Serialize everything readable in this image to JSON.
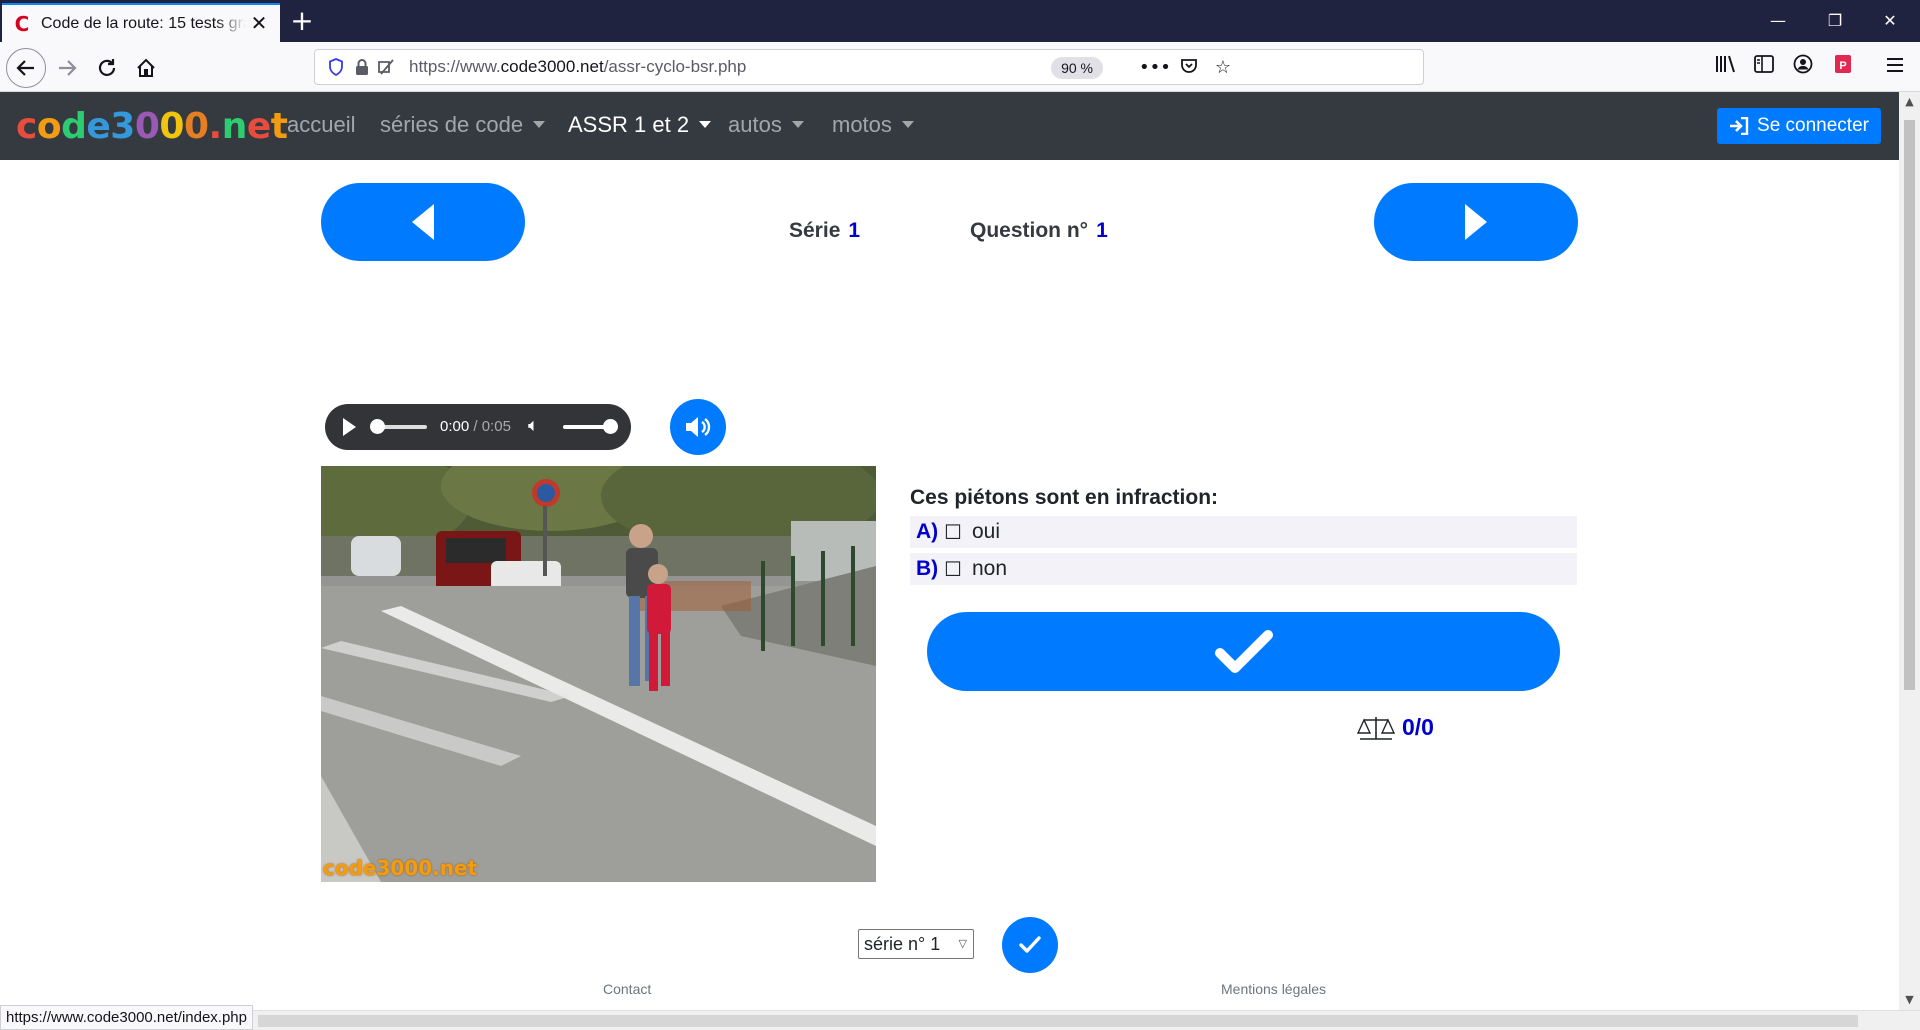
{
  "browser": {
    "tab_title": "Code de la route: 15 tests gratuits",
    "favicon_letter": "C",
    "new_tab_label": "+",
    "url_prefix": "https://www.",
    "url_domain": "code3000.net",
    "url_path": "/assr-cyclo-bsr.php",
    "zoom": "90 %",
    "status_url": "https://www.code3000.net/index.php",
    "icons": [
      "shield-icon",
      "lock-icon",
      "tracking-icon",
      "more-icon",
      "pocket-icon",
      "bookmark-star-icon",
      "library-icon",
      "sidebar-icon",
      "account-icon",
      "extension-icon",
      "menu-icon"
    ]
  },
  "site": {
    "logo_letters": [
      {
        "ch": "c",
        "color": "#e74c3c"
      },
      {
        "ch": "o",
        "color": "#f39c12"
      },
      {
        "ch": "d",
        "color": "#2ecc71"
      },
      {
        "ch": "e",
        "color": "#3498db"
      },
      {
        "ch": "3",
        "color": "#3498db"
      },
      {
        "ch": "0",
        "color": "#9b59b6"
      },
      {
        "ch": "0",
        "color": "#f1c40f"
      },
      {
        "ch": "0",
        "color": "#e67e22"
      },
      {
        "ch": ".",
        "color": "#e74c3c"
      },
      {
        "ch": "n",
        "color": "#2ecc71"
      },
      {
        "ch": "e",
        "color": "#e74c3c"
      },
      {
        "ch": "t",
        "color": "#f39c12"
      }
    ],
    "menu": {
      "home": "accueil",
      "series": "séries de code",
      "assr": "ASSR 1 et 2",
      "autos": "autos",
      "motos": "motos"
    },
    "login_label": "Se connecter",
    "accent_color": "#007bff"
  },
  "quiz": {
    "serie_label": "Série",
    "serie_number": "1",
    "question_label": "Question n°",
    "question_number": "1",
    "audio": {
      "current_time": "0:00",
      "separator": " / ",
      "duration": "0:05"
    },
    "image_watermark": "code3000.net",
    "question_text": "Ces piétons sont en infraction:",
    "answers": [
      {
        "letter": "A)",
        "box": "☐",
        "text": "oui"
      },
      {
        "letter": "B)",
        "box": "☐",
        "text": "non"
      }
    ],
    "score": "0/0"
  },
  "bottom": {
    "select_value": "série n° 1",
    "contact": "Contact",
    "legal": "Mentions légales"
  }
}
